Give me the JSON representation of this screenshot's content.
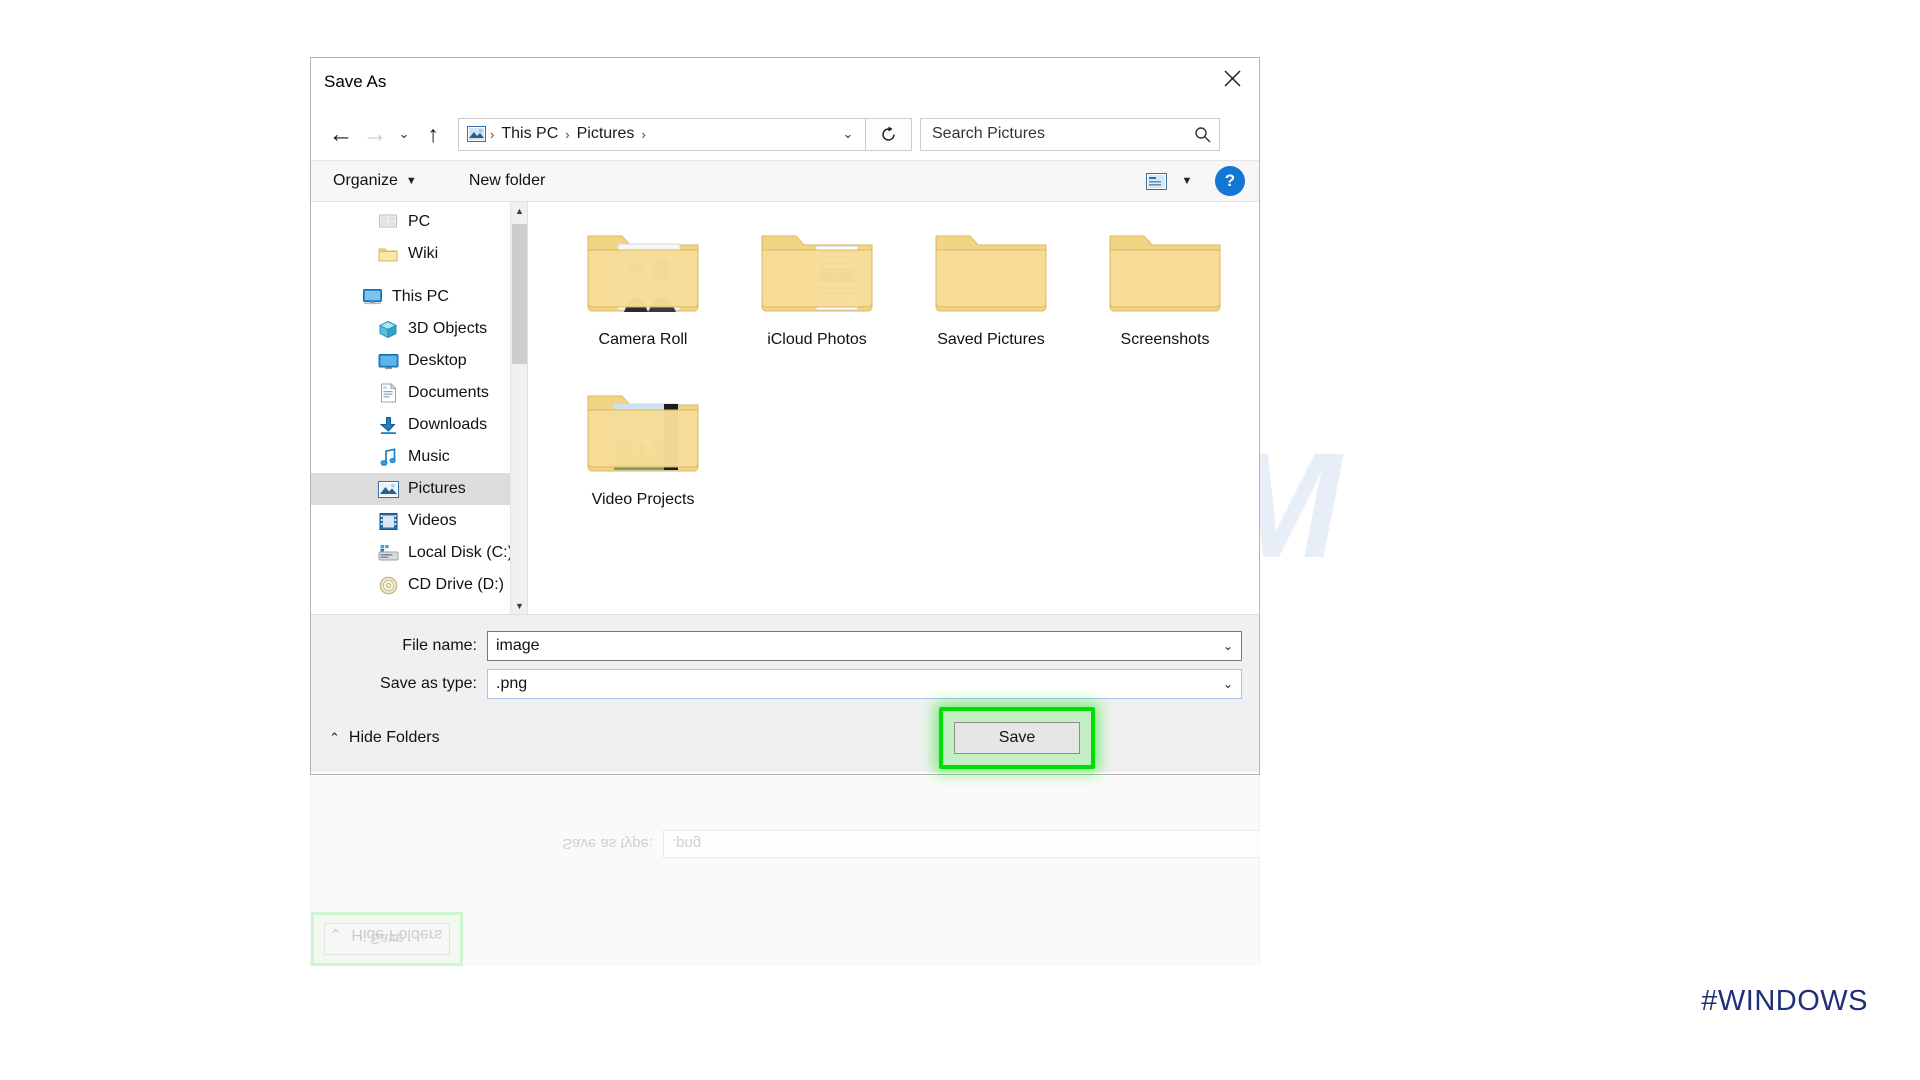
{
  "dialog": {
    "title": "Save As",
    "close_label": "Close"
  },
  "nav": {
    "back_icon": "back-arrow-icon",
    "forward_icon": "forward-arrow-icon",
    "recent_icon": "chevron-down-icon",
    "up_icon": "up-arrow-icon",
    "refresh_icon": "refresh-icon",
    "address_icon": "pictures-folder-icon",
    "breadcrumbs": [
      "This PC",
      "Pictures"
    ],
    "separator": "›",
    "address_dropdown_icon": "chevron-down-icon"
  },
  "search": {
    "placeholder": "Search Pictures",
    "value": "Search Pictures",
    "icon": "search-icon"
  },
  "toolbar": {
    "organize_label": "Organize",
    "organize_caret": "▼",
    "new_folder_label": "New folder",
    "view_icon": "view-layout-icon",
    "view_caret": "▼",
    "help_label": "?"
  },
  "sidebar": {
    "items": [
      {
        "label": "PC",
        "icon": "pc-icon",
        "level": 2,
        "selected": false,
        "gap_before": false
      },
      {
        "label": "Wiki",
        "icon": "folder-icon",
        "level": 2,
        "selected": false,
        "gap_before": false
      },
      {
        "label": "This PC",
        "icon": "this-pc-icon",
        "level": 1,
        "selected": false,
        "gap_before": true
      },
      {
        "label": "3D Objects",
        "icon": "3d-objects-icon",
        "level": 2,
        "selected": false,
        "gap_before": false
      },
      {
        "label": "Desktop",
        "icon": "desktop-icon",
        "level": 2,
        "selected": false,
        "gap_before": false
      },
      {
        "label": "Documents",
        "icon": "documents-icon",
        "level": 2,
        "selected": false,
        "gap_before": false
      },
      {
        "label": "Downloads",
        "icon": "downloads-icon",
        "level": 2,
        "selected": false,
        "gap_before": false
      },
      {
        "label": "Music",
        "icon": "music-icon",
        "level": 2,
        "selected": false,
        "gap_before": false
      },
      {
        "label": "Pictures",
        "icon": "pictures-icon",
        "level": 2,
        "selected": true,
        "gap_before": false
      },
      {
        "label": "Videos",
        "icon": "videos-icon",
        "level": 2,
        "selected": false,
        "gap_before": false
      },
      {
        "label": "Local Disk (C:)",
        "icon": "local-disk-icon",
        "level": 2,
        "selected": false,
        "gap_before": false
      },
      {
        "label": "CD Drive (D:)",
        "icon": "cd-drive-icon",
        "level": 2,
        "selected": false,
        "gap_before": false
      }
    ],
    "scroll_up_icon": "chevron-up-icon",
    "scroll_down_icon": "chevron-down-icon"
  },
  "content": {
    "folders": [
      {
        "label": "Camera Roll",
        "thumb": "photo-people"
      },
      {
        "label": "iCloud Photos",
        "thumb": "documents-stack"
      },
      {
        "label": "Saved Pictures",
        "thumb": "none"
      },
      {
        "label": "Screenshots",
        "thumb": "none"
      },
      {
        "label": "Video Projects",
        "thumb": "photo-house"
      }
    ]
  },
  "form": {
    "file_name_label": "File name:",
    "file_name_value": "image",
    "save_type_label": "Save as type:",
    "save_type_value": ".png",
    "dropdown_icon": "chevron-down-icon"
  },
  "footer": {
    "hide_folders_label": "Hide Folders",
    "hide_folders_caret": "⌃",
    "save_label": "Save"
  },
  "reflection": {
    "hide_folders_label": "Hide Folders",
    "save_label": "Save",
    "save_type_label": "Save as type:",
    "save_type_value": ".png"
  },
  "overlay": {
    "watermark": "NeuronVM",
    "hashtag": "#WINDOWS"
  },
  "colors": {
    "highlight_green": "#00e000",
    "help_blue": "#1277d4",
    "hashtag_blue": "#1f2f78",
    "selection_gray": "#dcdcdc",
    "folder_yellow": "#f5d97b"
  }
}
